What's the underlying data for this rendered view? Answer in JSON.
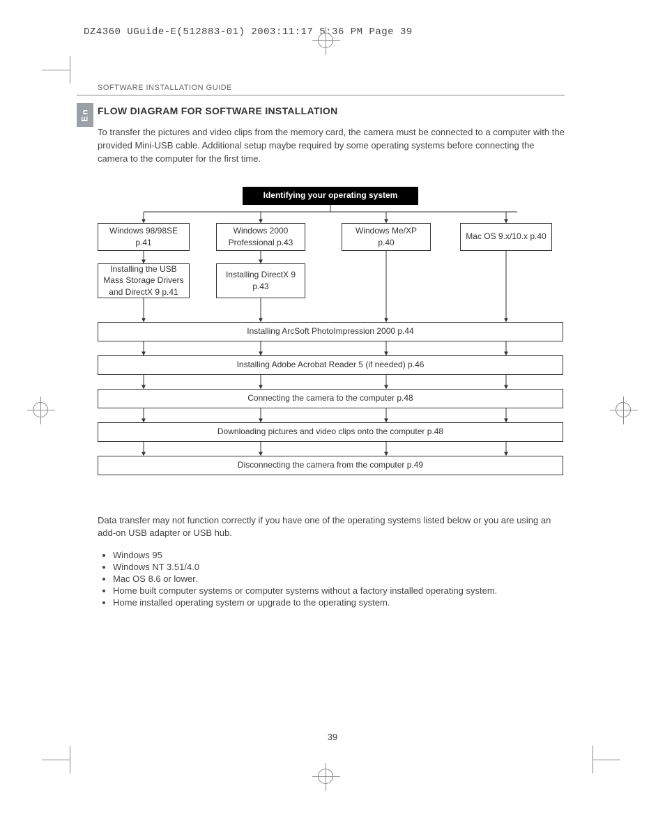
{
  "print_header": "DZ4360 UGuide-E(512883-01)  2003:11:17  5:36 PM  Page 39",
  "section_label": "SOFTWARE INSTALLATION GUIDE",
  "lang_badge": "En",
  "title": "FLOW DIAGRAM FOR SOFTWARE INSTALLATION",
  "intro": "To transfer the pictures and video clips from the memory card, the camera must be connected to a computer with the provided Mini-USB cable.  Additional setup maybe required by some operating systems before connecting the camera to the computer for the first time.",
  "diagram": {
    "header": "Identifying your operating system",
    "os": [
      "Windows 98/98SE p.41",
      "Windows 2000 Professional p.43",
      "Windows Me/XP p.40",
      "Mac OS 9.x/10.x p.40"
    ],
    "sub": [
      "Installing the USB Mass Storage Drivers and DirectX 9 p.41",
      "Installing DirectX 9 p.43"
    ],
    "rows": [
      "Installing ArcSoft PhotoImpression 2000 p.44",
      "Installing Adobe Acrobat Reader 5 (if needed) p.46",
      "Connecting the camera to the computer p.48",
      "Downloading pictures and video clips onto the computer p.48",
      "Disconnecting the camera from the computer p.49"
    ]
  },
  "note": "Data transfer may not function correctly if you have one of the operating systems listed below or you are using an add-on USB adapter or USB hub.",
  "os_limits": [
    "Windows 95",
    "Windows NT 3.51/4.0",
    "Mac OS 8.6 or lower.",
    "Home built computer systems or computer systems without a factory installed operating system.",
    "Home installed operating system or upgrade to the operating system."
  ],
  "page_number": "39"
}
